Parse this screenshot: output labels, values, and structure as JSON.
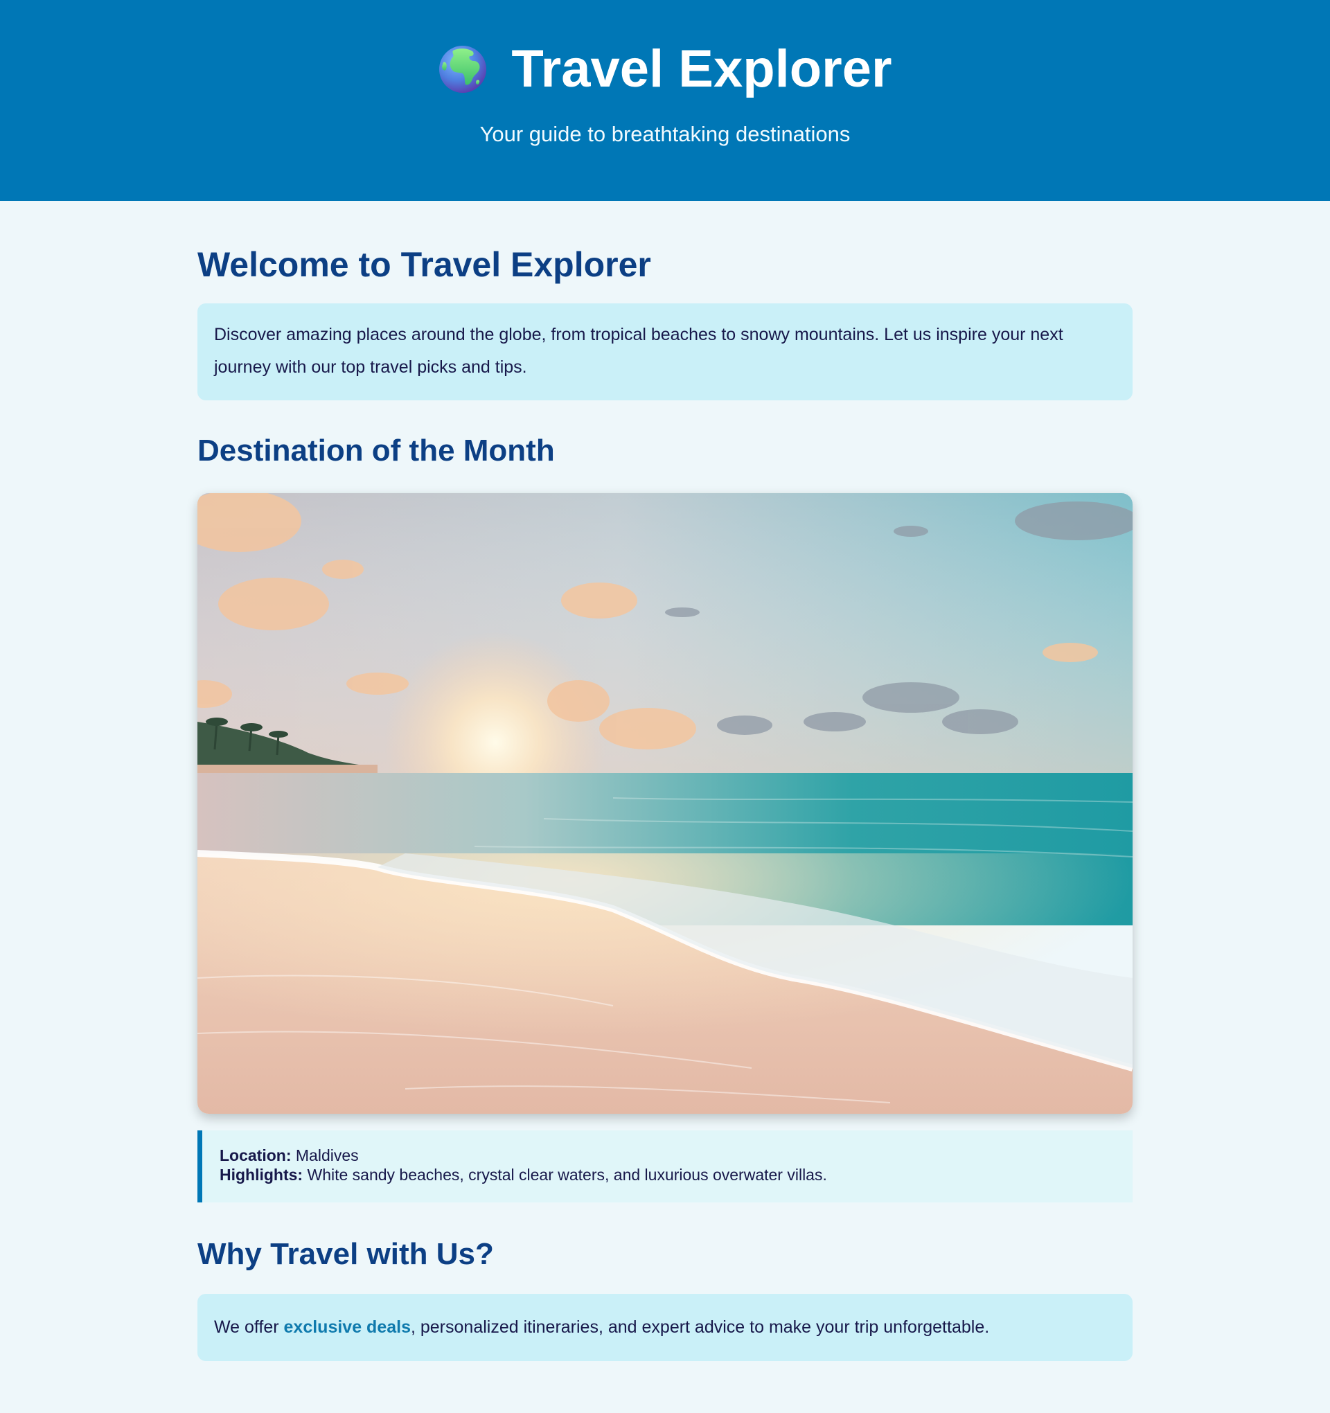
{
  "header": {
    "icon": "globe-europe-africa-icon",
    "title": "Travel Explorer",
    "tagline": "Your guide to breathtaking destinations"
  },
  "welcome": {
    "heading": "Welcome to Travel Explorer",
    "text": "Discover amazing places around the globe, from tropical beaches to snowy mountains. Let us inspire your next journey with our top travel picks and tips."
  },
  "destination": {
    "heading": "Destination of the Month",
    "image_subject": "sunset-beach-photo",
    "location_label": "Location:",
    "location_value": "Maldives",
    "highlights_label": "Highlights:",
    "highlights_value": "White sandy beaches, crystal clear waters, and luxurious overwater villas."
  },
  "why": {
    "heading": "Why Travel with Us?",
    "text_before": "We offer ",
    "highlight": "exclusive deals",
    "text_after": ", personalized itineraries, and expert advice to make your trip unforgettable."
  },
  "colors": {
    "header_bg": "#0077b6",
    "page_bg": "#eef7fa",
    "heading": "#0c3f84",
    "box_bg": "#caf0f8",
    "accent": "#0f7aad"
  }
}
